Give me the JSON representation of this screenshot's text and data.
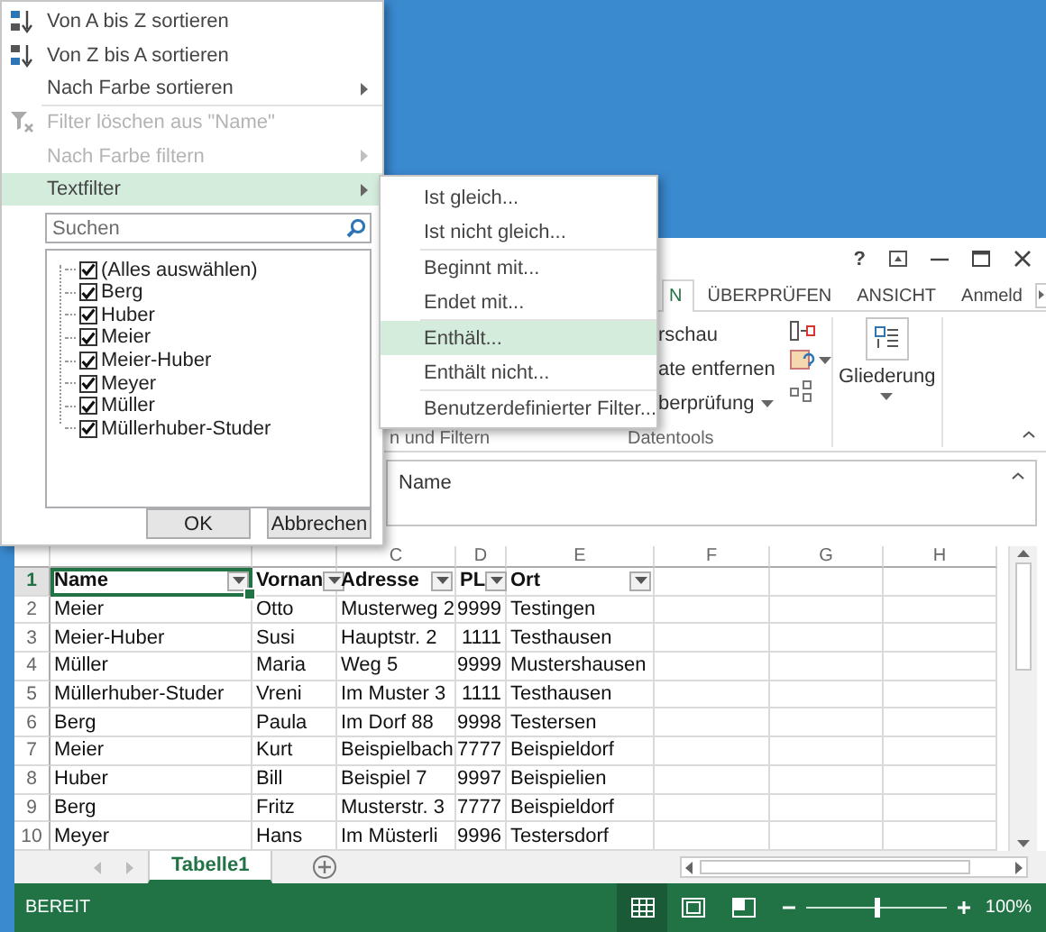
{
  "filter_menu": {
    "groups": [
      [
        {
          "kind": "sort-ascending",
          "label": "Von A bis Z sortieren",
          "submenu": false,
          "disabled": false,
          "highlighted": false
        },
        {
          "kind": "sort-descending",
          "label": "Von Z bis A sortieren",
          "submenu": false,
          "disabled": false,
          "highlighted": false
        },
        {
          "kind": "plain",
          "label": "Nach Farbe sortieren",
          "submenu": true,
          "disabled": false,
          "highlighted": false
        }
      ],
      [
        {
          "kind": "clear-filter",
          "label": "Filter löschen aus \"Name\"",
          "submenu": false,
          "disabled": true,
          "highlighted": false
        },
        {
          "kind": "plain",
          "label": "Nach Farbe filtern",
          "submenu": true,
          "disabled": true,
          "highlighted": false
        },
        {
          "kind": "plain",
          "label": "Textfilter",
          "submenu": true,
          "disabled": false,
          "highlighted": true
        }
      ]
    ],
    "search": {
      "placeholder": "Suchen"
    },
    "values": [
      {
        "label": "(Alles auswählen)",
        "checked": true
      },
      {
        "label": "Berg",
        "checked": true
      },
      {
        "label": "Huber",
        "checked": true
      },
      {
        "label": "Meier",
        "checked": true
      },
      {
        "label": "Meier-Huber",
        "checked": true
      },
      {
        "label": "Meyer",
        "checked": true
      },
      {
        "label": "Müller",
        "checked": true
      },
      {
        "label": "Müllerhuber-Studer",
        "checked": true
      }
    ],
    "buttons": [
      "OK",
      "Abbrechen"
    ]
  },
  "text_filter_submenu": {
    "groups": [
      [
        {
          "label": "Ist gleich...",
          "highlighted": false
        },
        {
          "label": "Ist nicht gleich...",
          "highlighted": false
        }
      ],
      [
        {
          "label": "Beginnt mit...",
          "highlighted": false
        },
        {
          "label": "Endet mit...",
          "highlighted": false
        }
      ],
      [
        {
          "label": "Enthält...",
          "highlighted": true
        },
        {
          "label": "Enthält nicht...",
          "highlighted": false
        }
      ],
      [
        {
          "label": "Benutzerdefinierter Filter...",
          "highlighted": false
        }
      ]
    ]
  },
  "window": {
    "help": "?"
  },
  "ribbon": {
    "tabs": [
      {
        "label": "N",
        "selected": true
      },
      {
        "label": "ÜBERPRÜFEN",
        "selected": false
      },
      {
        "label": "ANSICHT",
        "selected": false
      },
      {
        "label": "Anmeld",
        "selected": false
      }
    ],
    "commands": [
      "rschau",
      "ate entfernen",
      "berprüfung"
    ],
    "outline_button": "Gliederung",
    "group_labels": [
      "n und Filtern",
      "Datentools"
    ]
  },
  "formula_bar": {
    "value": "Name"
  },
  "sheet": {
    "column_headers": [
      "C",
      "D",
      "E",
      "F",
      "G",
      "H"
    ],
    "header_row": {
      "number": "1",
      "cells": [
        {
          "text": "Name",
          "selected": true
        },
        {
          "text": "Vornan",
          "selected": false
        },
        {
          "text": "Adresse",
          "selected": false
        },
        {
          "text": "PL",
          "selected": false
        },
        {
          "text": "Ort",
          "selected": false
        }
      ]
    },
    "rows": [
      {
        "number": "2",
        "cells": [
          "Meier",
          "Otto",
          "Musterweg 2",
          "9999",
          "Testingen"
        ]
      },
      {
        "number": "3",
        "cells": [
          "Meier-Huber",
          "Susi",
          "Hauptstr. 2",
          "1111",
          "Testhausen"
        ]
      },
      {
        "number": "4",
        "cells": [
          "Müller",
          "Maria",
          "Weg 5",
          "9999",
          "Mustershausen"
        ]
      },
      {
        "number": "5",
        "cells": [
          "Müllerhuber-Studer",
          "Vreni",
          "Im Muster 3",
          "1111",
          "Testhausen"
        ]
      },
      {
        "number": "6",
        "cells": [
          "Berg",
          "Paula",
          "Im Dorf 88",
          "9998",
          "Testersen"
        ]
      },
      {
        "number": "7",
        "cells": [
          "Meier",
          "Kurt",
          "Beispielbach",
          "7777",
          "Beispieldorf"
        ]
      },
      {
        "number": "8",
        "cells": [
          "Huber",
          "Bill",
          "Beispiel 7",
          "9997",
          "Beispielien"
        ]
      },
      {
        "number": "9",
        "cells": [
          "Berg",
          "Fritz",
          "Musterstr. 3",
          "7777",
          "Beispieldorf"
        ]
      },
      {
        "number": "10",
        "cells": [
          "Meyer",
          "Hans",
          "Im Müsterli",
          "9996",
          "Testersdorf"
        ]
      }
    ]
  },
  "sheet_tabs": [
    {
      "label": "Tabelle1",
      "selected": true
    }
  ],
  "status_bar": {
    "text": "BEREIT",
    "zoom": "100%",
    "zoom_level": {
      "level": 0.5
    }
  }
}
